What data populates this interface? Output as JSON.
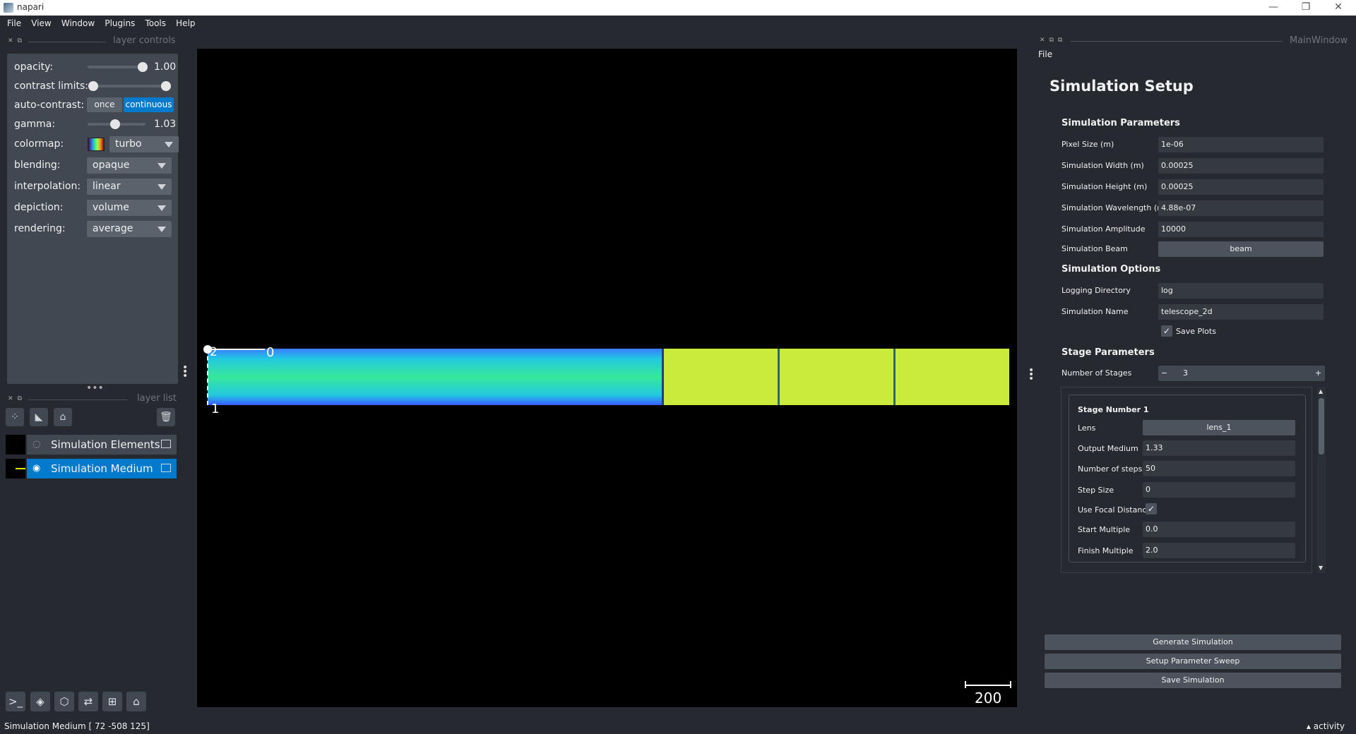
{
  "window": {
    "title": "napari",
    "minimize": "—",
    "restore": "❐",
    "close": "✕"
  },
  "menu": [
    "File",
    "View",
    "Window",
    "Plugins",
    "Tools",
    "Help"
  ],
  "layer_controls": {
    "title": "layer controls",
    "opacity": {
      "label": "opacity:",
      "value": "1.00",
      "fraction": 1.0
    },
    "contrast_limits": {
      "label": "contrast limits:",
      "low": 0.0,
      "high": 1.0
    },
    "auto_contrast": {
      "label": "auto-contrast:",
      "once": "once",
      "continuous": "continuous"
    },
    "gamma": {
      "label": "gamma:",
      "value": "1.03",
      "fraction": 0.46
    },
    "colormap": {
      "label": "colormap:",
      "value": "turbo"
    },
    "blending": {
      "label": "blending:",
      "value": "opaque"
    },
    "interpolation": {
      "label": "interpolation:",
      "value": "linear"
    },
    "depiction": {
      "label": "depiction:",
      "value": "volume"
    },
    "rendering": {
      "label": "rendering:",
      "value": "average"
    }
  },
  "layer_list": {
    "title": "layer list",
    "layers": [
      {
        "name": "Simulation Elements",
        "selected": false
      },
      {
        "name": "Simulation Medium",
        "selected": true
      }
    ]
  },
  "canvas": {
    "axis_labels": {
      "a": "2",
      "b": "0",
      "c": "1"
    },
    "scale_bar": "200"
  },
  "status": {
    "text": "Simulation Medium [  72 -508  125]",
    "activity": "activity"
  },
  "right_panel": {
    "dock_title": "MainWindow",
    "menu_file": "File",
    "heading": "Simulation Setup",
    "sim_params_title": "Simulation Parameters",
    "sim_params": [
      {
        "label": "Pixel Size (m)",
        "value": "1e-06"
      },
      {
        "label": "Simulation Width (m)",
        "value": "0.00025"
      },
      {
        "label": "Simulation Height (m)",
        "value": "0.00025"
      },
      {
        "label": "Simulation Wavelength (m)",
        "value": "4.88e-07"
      },
      {
        "label": "Simulation Amplitude",
        "value": "10000"
      }
    ],
    "beam": {
      "label": "Simulation Beam",
      "button": "beam"
    },
    "sim_options_title": "Simulation Options",
    "logging": {
      "label": "Logging Directory",
      "value": "log"
    },
    "sim_name": {
      "label": "Simulation Name",
      "value": "telescope_2d"
    },
    "save_plots": {
      "label": "Save Plots",
      "checked": true
    },
    "stage_params_title": "Stage Parameters",
    "num_stages": {
      "label": "Number of Stages",
      "value": "3",
      "minus": "−",
      "plus": "+"
    },
    "stage": {
      "title": "Stage Number 1",
      "lens": {
        "label": "Lens",
        "button": "lens_1"
      },
      "output_medium": {
        "label": "Output Medium",
        "value": "1.33"
      },
      "num_steps": {
        "label": "Number of steps",
        "value": "50"
      },
      "step_size": {
        "label": "Step Size",
        "value": "0"
      },
      "use_focal": {
        "label": "Use Focal Distance",
        "checked": true
      },
      "start_multiple": {
        "label": "Start Multiple",
        "value": "0.0"
      },
      "finish_multiple": {
        "label": "Finish Multiple",
        "value": "2.0"
      }
    },
    "buttons": {
      "generate": "Generate Simulation",
      "sweep": "Setup Parameter Sweep",
      "save": "Save Simulation"
    }
  }
}
